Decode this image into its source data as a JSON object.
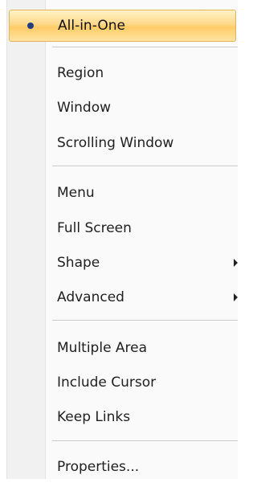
{
  "menu": {
    "items": [
      {
        "label": "All-in-One",
        "checked": true,
        "selected": true
      },
      {
        "label": "Region"
      },
      {
        "label": "Window"
      },
      {
        "label": "Scrolling Window"
      },
      {
        "label": "Menu"
      },
      {
        "label": "Full Screen"
      },
      {
        "label": "Shape",
        "submenu": true
      },
      {
        "label": "Advanced",
        "submenu": true
      },
      {
        "label": "Multiple Area"
      },
      {
        "label": "Include Cursor"
      },
      {
        "label": "Keep Links"
      },
      {
        "label": "Properties..."
      }
    ]
  },
  "colors": {
    "highlight": "#ffd88b",
    "check_dot": "#243d7c"
  }
}
